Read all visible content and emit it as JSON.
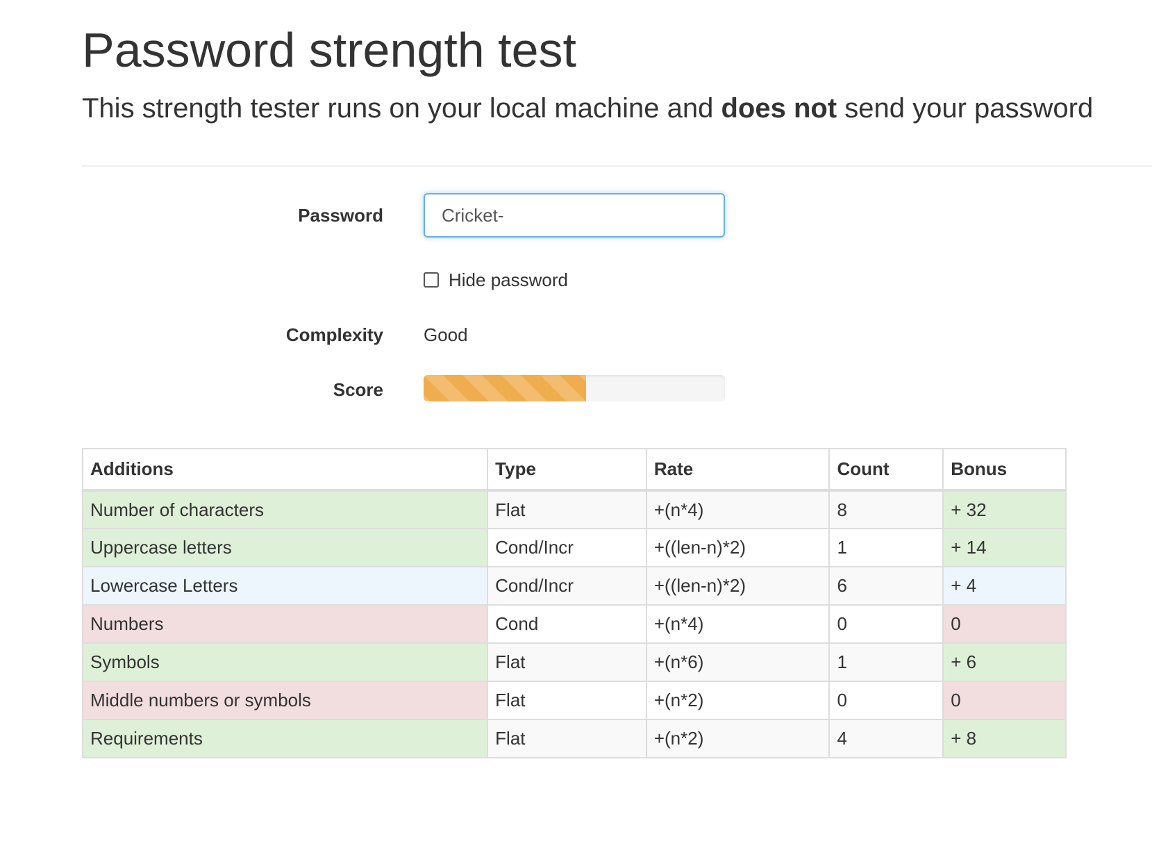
{
  "header": {
    "title": "Password strength test",
    "lead_before": "This strength tester runs on your local machine and ",
    "lead_bold": "does not",
    "lead_after": " send your password"
  },
  "form": {
    "password_label": "Password",
    "password_value": "Cricket-",
    "hide_password_label": "Hide password",
    "hide_password_checked": false,
    "complexity_label": "Complexity",
    "complexity_value": "Good",
    "score_label": "Score",
    "score_fraction": 0.54,
    "score_color": "#f0ad4e"
  },
  "table": {
    "headers": [
      "Additions",
      "Type",
      "Rate",
      "Count",
      "Bonus"
    ],
    "rows": [
      {
        "name": "Number of characters",
        "type": "Flat",
        "rate": "+(n*4)",
        "count": "8",
        "bonus": "+ 32",
        "status": "success"
      },
      {
        "name": "Uppercase letters",
        "type": "Cond/Incr",
        "rate": "+((len-n)*2)",
        "count": "1",
        "bonus": "+ 14",
        "status": "success"
      },
      {
        "name": "Lowercase Letters",
        "type": "Cond/Incr",
        "rate": "+((len-n)*2)",
        "count": "6",
        "bonus": "+ 4",
        "status": "info"
      },
      {
        "name": "Numbers",
        "type": "Cond",
        "rate": "+(n*4)",
        "count": "0",
        "bonus": "0",
        "status": "danger"
      },
      {
        "name": "Symbols",
        "type": "Flat",
        "rate": "+(n*6)",
        "count": "1",
        "bonus": "+ 6",
        "status": "success"
      },
      {
        "name": "Middle numbers or symbols",
        "type": "Flat",
        "rate": "+(n*2)",
        "count": "0",
        "bonus": "0",
        "status": "danger"
      },
      {
        "name": "Requirements",
        "type": "Flat",
        "rate": "+(n*2)",
        "count": "4",
        "bonus": "+ 8",
        "status": "success"
      }
    ]
  }
}
